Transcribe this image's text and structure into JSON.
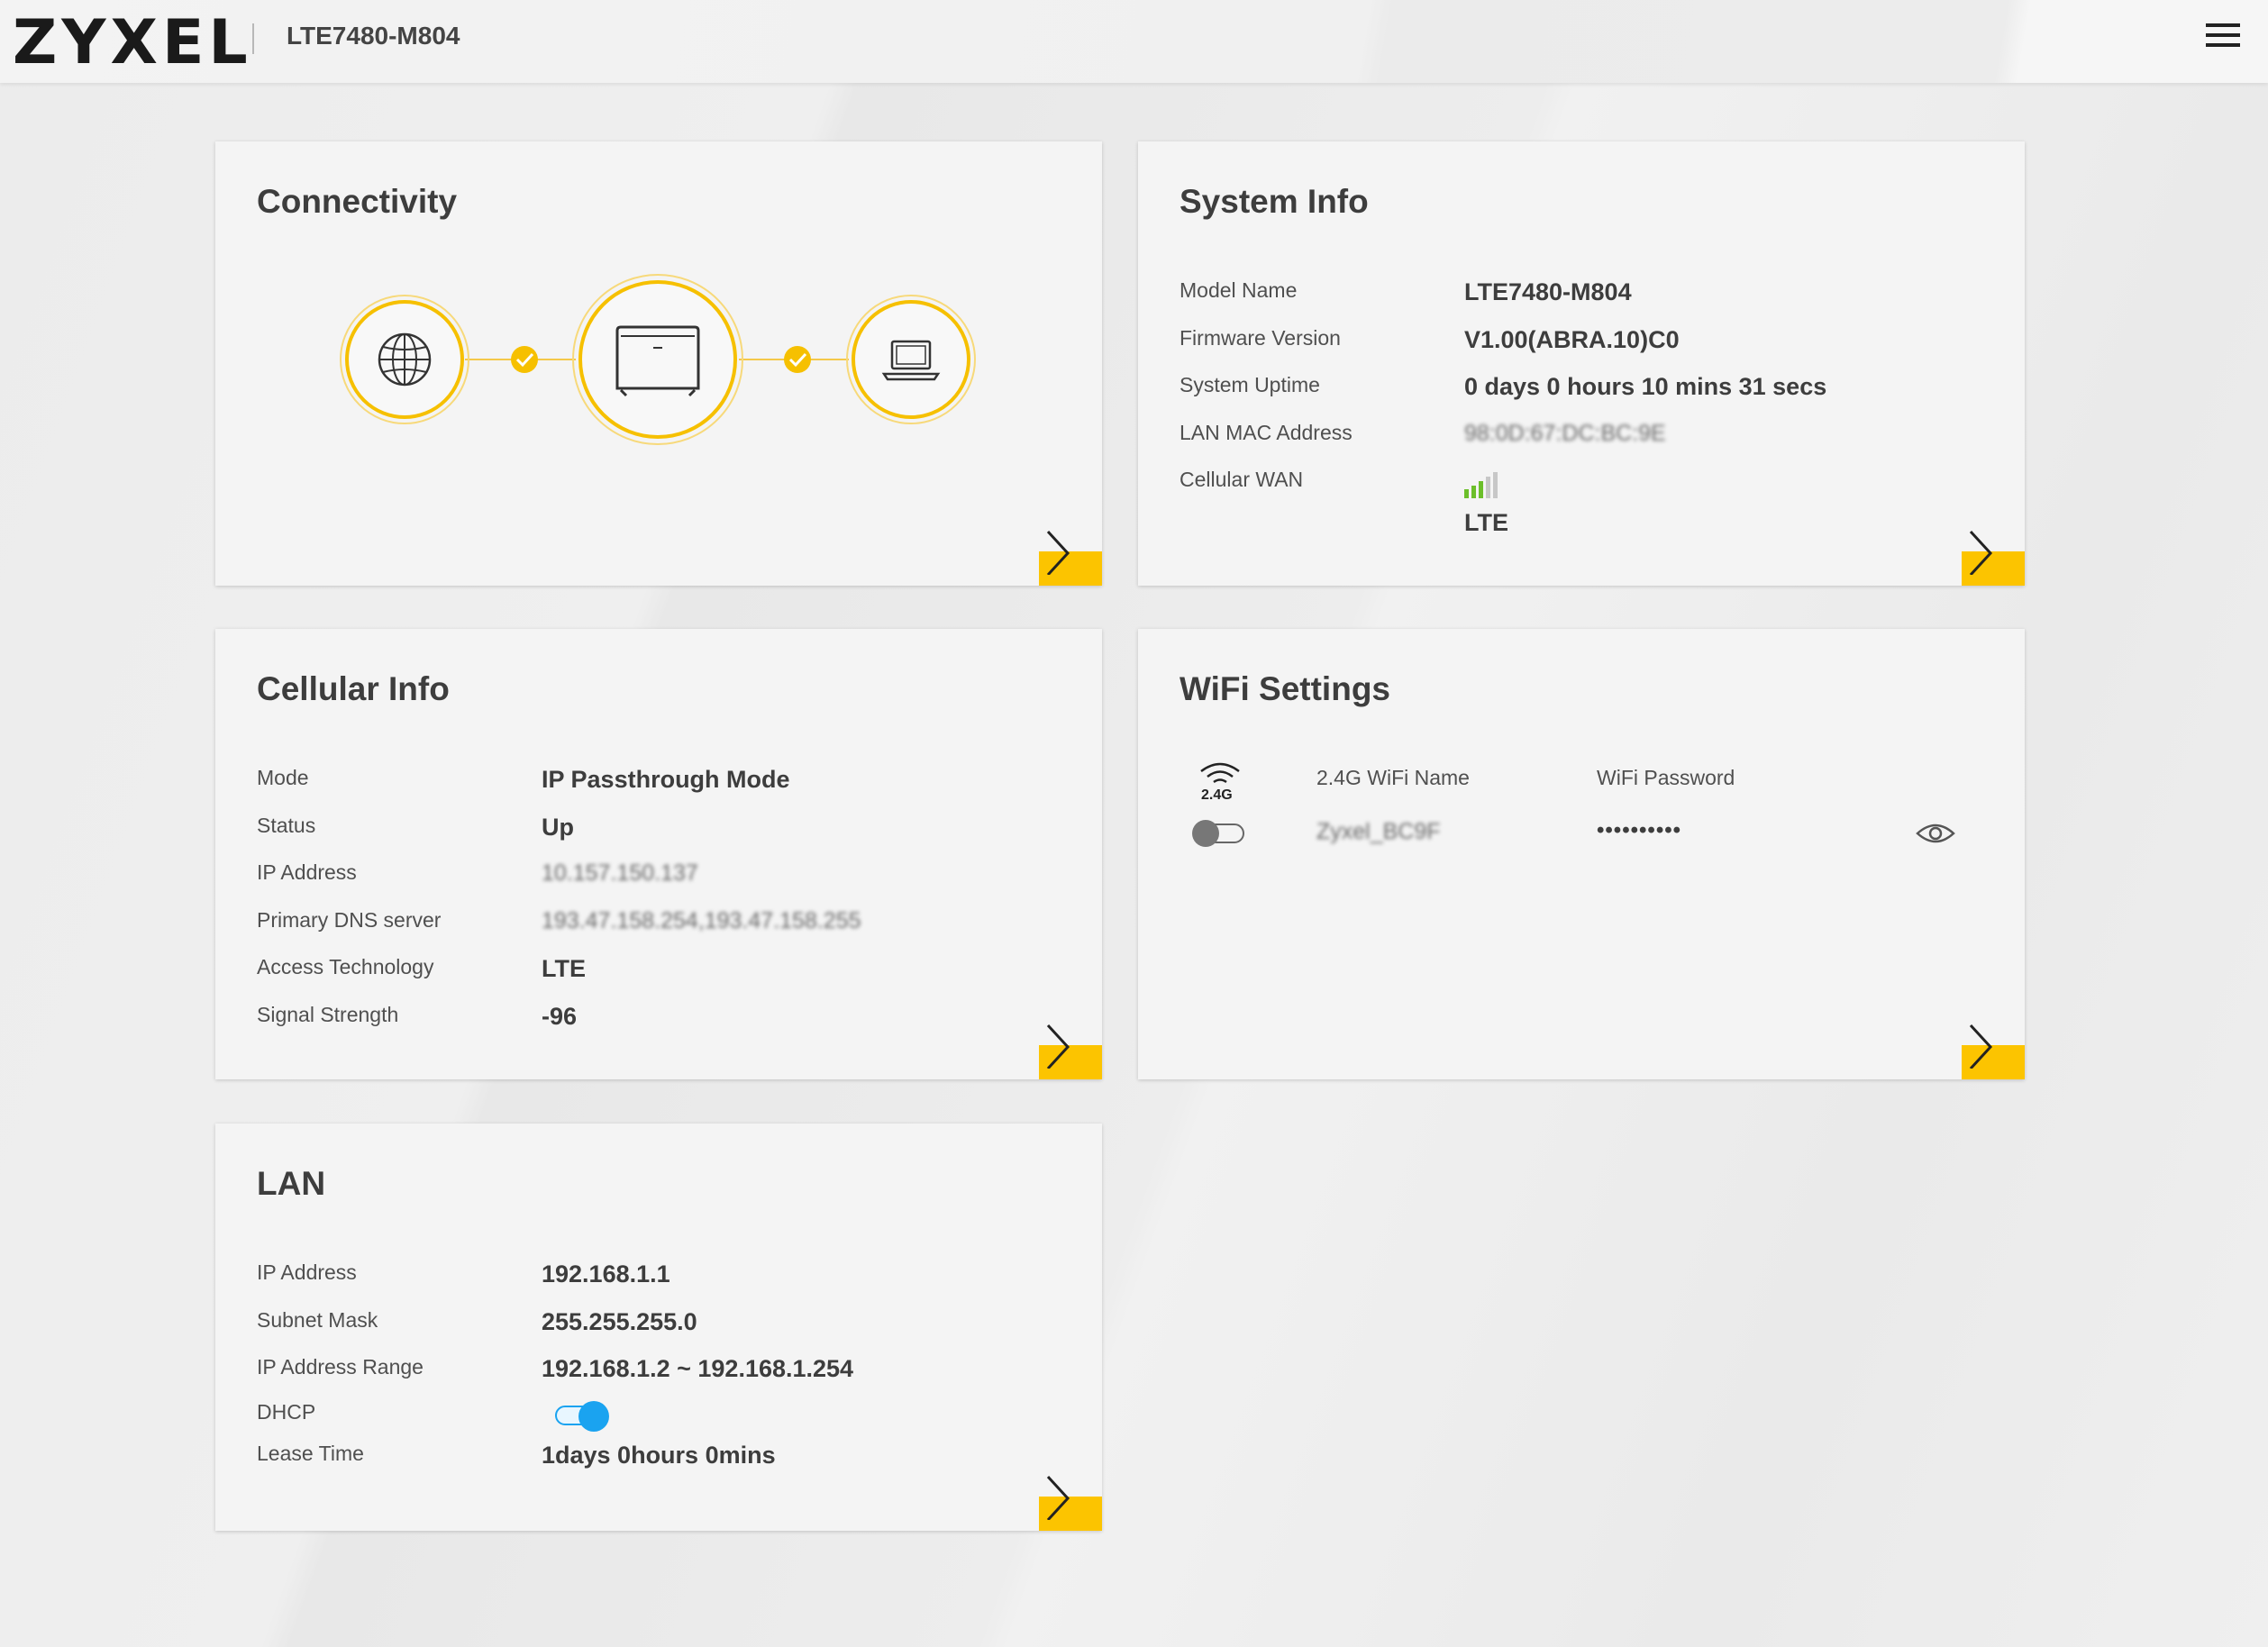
{
  "header": {
    "logo": "ZYXEL",
    "model": "LTE7480-M804",
    "menu_icon": "hamburger-menu-icon"
  },
  "connectivity": {
    "title": "Connectivity",
    "nodes": [
      "globe-icon",
      "router-icon",
      "laptop-icon"
    ],
    "links": [
      "check-icon",
      "check-icon"
    ],
    "accent": "#f9c300"
  },
  "system_info": {
    "title": "System Info",
    "rows": [
      {
        "label": "Model Name",
        "value": "LTE7480-M804"
      },
      {
        "label": "Firmware Version",
        "value": "V1.00(ABRA.10)C0"
      },
      {
        "label": "System Uptime",
        "value": "0 days 0 hours 10 mins 31 secs"
      },
      {
        "label": "LAN MAC Address",
        "value": "98:0D:67:DC:BC:9E"
      },
      {
        "label": "Cellular WAN",
        "value": "LTE"
      }
    ],
    "signal_bars_active": 3,
    "signal_bars_total": 5
  },
  "cellular_info": {
    "title": "Cellular Info",
    "rows": [
      {
        "label": "Mode",
        "value": "IP Passthrough Mode"
      },
      {
        "label": "Status",
        "value": "Up"
      },
      {
        "label": "IP Address",
        "value": "10.157.150.137"
      },
      {
        "label": "Primary DNS server",
        "value": "193.47.158.254,193.47.158.255"
      },
      {
        "label": "Access Technology",
        "value": "LTE"
      },
      {
        "label": "Signal Strength",
        "value": "-96"
      }
    ]
  },
  "wifi": {
    "title": "WiFi Settings",
    "band": "2.4G",
    "name_header": "2.4G WiFi Name",
    "password_header": "WiFi Password",
    "ssid": "Zyxel_BC9F",
    "password_mask": "••••••••••",
    "enabled": false
  },
  "lan": {
    "title": "LAN",
    "rows": [
      {
        "label": "IP Address",
        "value": "192.168.1.1"
      },
      {
        "label": "Subnet Mask",
        "value": "255.255.255.0"
      },
      {
        "label": "IP Address Range",
        "value": "192.168.1.2 ~ 192.168.1.254"
      },
      {
        "label": "DHCP",
        "value": ""
      },
      {
        "label": "Lease Time",
        "value": "1days 0hours 0mins"
      }
    ],
    "dhcp_enabled": true
  }
}
